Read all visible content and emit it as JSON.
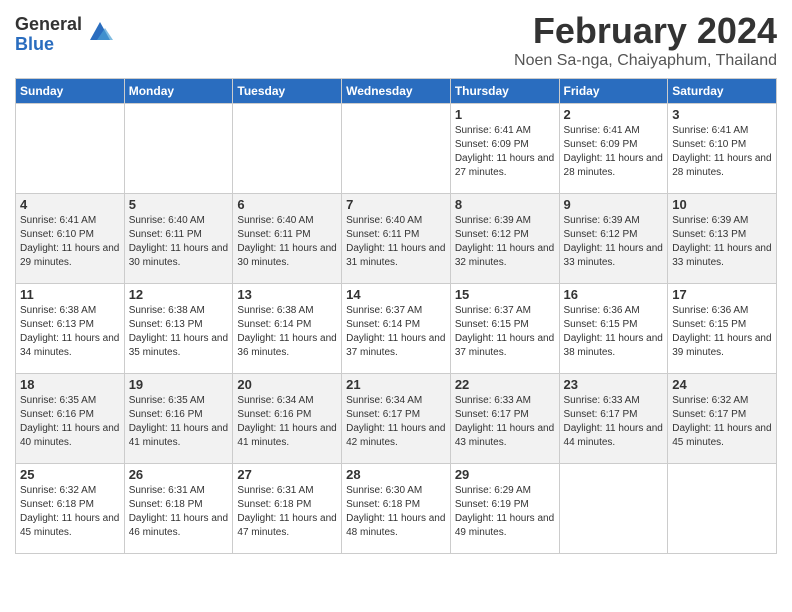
{
  "logo": {
    "general": "General",
    "blue": "Blue"
  },
  "header": {
    "month": "February 2024",
    "location": "Noen Sa-nga, Chaiyaphum, Thailand"
  },
  "days_of_week": [
    "Sunday",
    "Monday",
    "Tuesday",
    "Wednesday",
    "Thursday",
    "Friday",
    "Saturday"
  ],
  "weeks": [
    [
      {
        "day": "",
        "info": ""
      },
      {
        "day": "",
        "info": ""
      },
      {
        "day": "",
        "info": ""
      },
      {
        "day": "",
        "info": ""
      },
      {
        "day": "1",
        "info": "Sunrise: 6:41 AM\nSunset: 6:09 PM\nDaylight: 11 hours and 27 minutes."
      },
      {
        "day": "2",
        "info": "Sunrise: 6:41 AM\nSunset: 6:09 PM\nDaylight: 11 hours and 28 minutes."
      },
      {
        "day": "3",
        "info": "Sunrise: 6:41 AM\nSunset: 6:10 PM\nDaylight: 11 hours and 28 minutes."
      }
    ],
    [
      {
        "day": "4",
        "info": "Sunrise: 6:41 AM\nSunset: 6:10 PM\nDaylight: 11 hours and 29 minutes."
      },
      {
        "day": "5",
        "info": "Sunrise: 6:40 AM\nSunset: 6:11 PM\nDaylight: 11 hours and 30 minutes."
      },
      {
        "day": "6",
        "info": "Sunrise: 6:40 AM\nSunset: 6:11 PM\nDaylight: 11 hours and 30 minutes."
      },
      {
        "day": "7",
        "info": "Sunrise: 6:40 AM\nSunset: 6:11 PM\nDaylight: 11 hours and 31 minutes."
      },
      {
        "day": "8",
        "info": "Sunrise: 6:39 AM\nSunset: 6:12 PM\nDaylight: 11 hours and 32 minutes."
      },
      {
        "day": "9",
        "info": "Sunrise: 6:39 AM\nSunset: 6:12 PM\nDaylight: 11 hours and 33 minutes."
      },
      {
        "day": "10",
        "info": "Sunrise: 6:39 AM\nSunset: 6:13 PM\nDaylight: 11 hours and 33 minutes."
      }
    ],
    [
      {
        "day": "11",
        "info": "Sunrise: 6:38 AM\nSunset: 6:13 PM\nDaylight: 11 hours and 34 minutes."
      },
      {
        "day": "12",
        "info": "Sunrise: 6:38 AM\nSunset: 6:13 PM\nDaylight: 11 hours and 35 minutes."
      },
      {
        "day": "13",
        "info": "Sunrise: 6:38 AM\nSunset: 6:14 PM\nDaylight: 11 hours and 36 minutes."
      },
      {
        "day": "14",
        "info": "Sunrise: 6:37 AM\nSunset: 6:14 PM\nDaylight: 11 hours and 37 minutes."
      },
      {
        "day": "15",
        "info": "Sunrise: 6:37 AM\nSunset: 6:15 PM\nDaylight: 11 hours and 37 minutes."
      },
      {
        "day": "16",
        "info": "Sunrise: 6:36 AM\nSunset: 6:15 PM\nDaylight: 11 hours and 38 minutes."
      },
      {
        "day": "17",
        "info": "Sunrise: 6:36 AM\nSunset: 6:15 PM\nDaylight: 11 hours and 39 minutes."
      }
    ],
    [
      {
        "day": "18",
        "info": "Sunrise: 6:35 AM\nSunset: 6:16 PM\nDaylight: 11 hours and 40 minutes."
      },
      {
        "day": "19",
        "info": "Sunrise: 6:35 AM\nSunset: 6:16 PM\nDaylight: 11 hours and 41 minutes."
      },
      {
        "day": "20",
        "info": "Sunrise: 6:34 AM\nSunset: 6:16 PM\nDaylight: 11 hours and 41 minutes."
      },
      {
        "day": "21",
        "info": "Sunrise: 6:34 AM\nSunset: 6:17 PM\nDaylight: 11 hours and 42 minutes."
      },
      {
        "day": "22",
        "info": "Sunrise: 6:33 AM\nSunset: 6:17 PM\nDaylight: 11 hours and 43 minutes."
      },
      {
        "day": "23",
        "info": "Sunrise: 6:33 AM\nSunset: 6:17 PM\nDaylight: 11 hours and 44 minutes."
      },
      {
        "day": "24",
        "info": "Sunrise: 6:32 AM\nSunset: 6:17 PM\nDaylight: 11 hours and 45 minutes."
      }
    ],
    [
      {
        "day": "25",
        "info": "Sunrise: 6:32 AM\nSunset: 6:18 PM\nDaylight: 11 hours and 45 minutes."
      },
      {
        "day": "26",
        "info": "Sunrise: 6:31 AM\nSunset: 6:18 PM\nDaylight: 11 hours and 46 minutes."
      },
      {
        "day": "27",
        "info": "Sunrise: 6:31 AM\nSunset: 6:18 PM\nDaylight: 11 hours and 47 minutes."
      },
      {
        "day": "28",
        "info": "Sunrise: 6:30 AM\nSunset: 6:18 PM\nDaylight: 11 hours and 48 minutes."
      },
      {
        "day": "29",
        "info": "Sunrise: 6:29 AM\nSunset: 6:19 PM\nDaylight: 11 hours and 49 minutes."
      },
      {
        "day": "",
        "info": ""
      },
      {
        "day": "",
        "info": ""
      }
    ]
  ]
}
